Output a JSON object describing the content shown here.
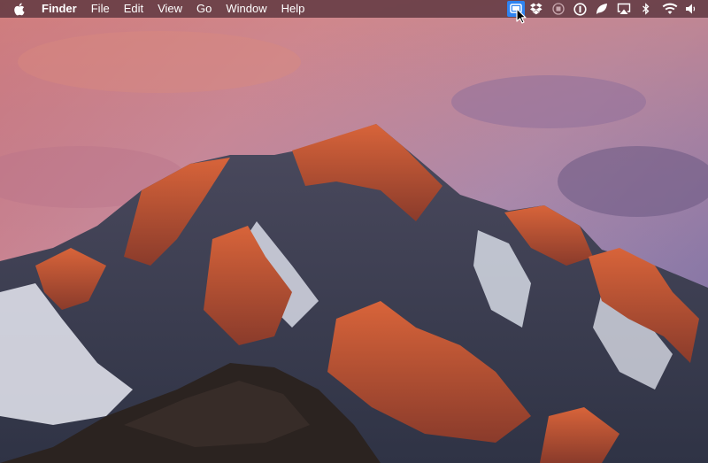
{
  "menubar": {
    "items": [
      "Finder",
      "File",
      "Edit",
      "View",
      "Go",
      "Window",
      "Help"
    ]
  },
  "status_icons": [
    "active-app-icon",
    "dropbox-icon",
    "record-icon",
    "onepassword-icon",
    "leaf-icon",
    "airplay-icon",
    "bluetooth-icon",
    "wifi-icon",
    "volume-icon"
  ],
  "colors": {
    "menubar_bg": "#5c363e",
    "active_icon_bg": "#2f83f0"
  }
}
